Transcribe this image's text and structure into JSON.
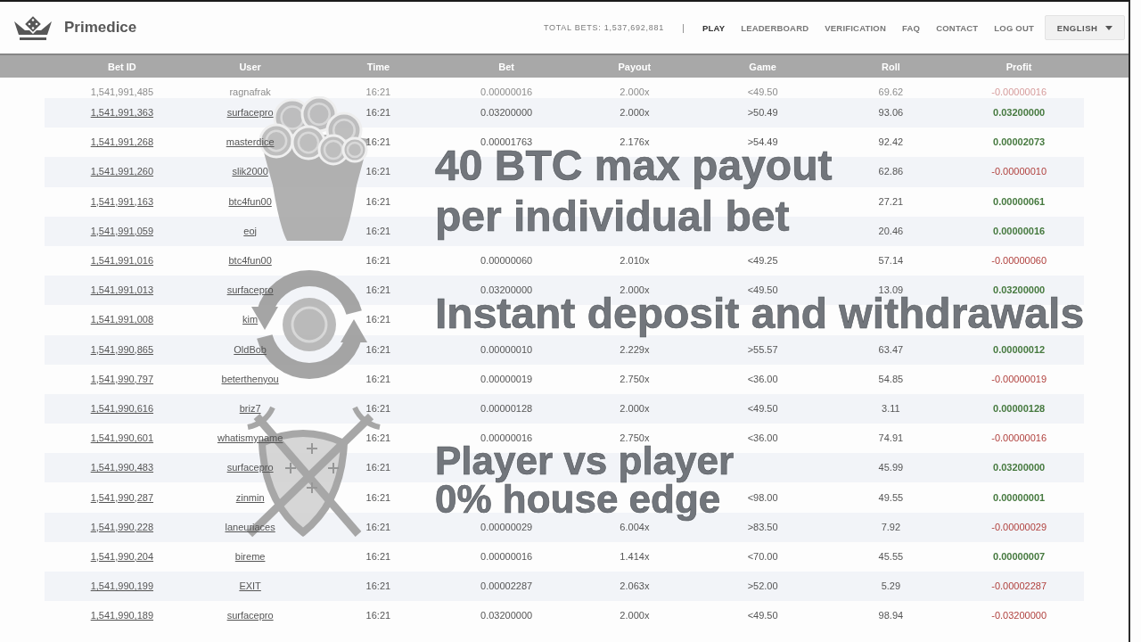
{
  "header": {
    "brand": "Primedice",
    "total_bets": "TOTAL BETS: 1,537,692,881",
    "separator": "|",
    "nav": [
      {
        "label": "PLAY",
        "selected": true
      },
      {
        "label": "LEADERBOARD",
        "selected": false
      },
      {
        "label": "VERIFICATION",
        "selected": false
      },
      {
        "label": "FAQ",
        "selected": false
      },
      {
        "label": "CONTACT",
        "selected": false
      },
      {
        "label": "LOG OUT",
        "selected": false
      }
    ],
    "language": "ENGLISH"
  },
  "table": {
    "columns": [
      "Bet ID",
      "User",
      "Time",
      "Bet",
      "Payout",
      "Game",
      "Roll",
      "Profit"
    ],
    "rows": [
      {
        "bet_id": "1,541,991,485",
        "user": "ragnafrak",
        "time": "16:21",
        "bet": "0.00000016",
        "payout": "2.000x",
        "game": "<49.50",
        "roll": "69.62",
        "profit": "-0.00000016",
        "won": false,
        "faded": true
      },
      {
        "bet_id": "1,541,991,363",
        "user": "surfacepro",
        "time": "16:21",
        "bet": "0.03200000",
        "payout": "2.000x",
        "game": ">50.49",
        "roll": "93.06",
        "profit": "0.03200000",
        "won": true,
        "faded": false
      },
      {
        "bet_id": "1,541,991,268",
        "user": "masterdice",
        "time": "16:21",
        "bet": "0.00001763",
        "payout": "2.176x",
        "game": ">54.49",
        "roll": "92.42",
        "profit": "0.00002073",
        "won": true,
        "faded": false
      },
      {
        "bet_id": "1,541,991,260",
        "user": "slik2000",
        "time": "16:21",
        "roll": "62.86",
        "profit": "-0.00000010",
        "won": false,
        "faded": false
      },
      {
        "bet_id": "1,541,991,163",
        "user": "btc4fun00",
        "time": "16:21",
        "roll": "27.21",
        "profit": "0.00000061",
        "won": true,
        "faded": false
      },
      {
        "bet_id": "1,541,991,059",
        "user": "eoj",
        "time": "16:21",
        "roll": "20.46",
        "profit": "0.00000016",
        "won": true,
        "faded": false
      },
      {
        "bet_id": "1,541,991,016",
        "user": "btc4fun00",
        "time": "16:21",
        "bet": "0.00000060",
        "payout": "2.010x",
        "game": "<49.25",
        "roll": "57.14",
        "profit": "-0.00000060",
        "won": false,
        "faded": false
      },
      {
        "bet_id": "1,541,991,013",
        "user": "surfacepro",
        "time": "16:21",
        "bet": "0.03200000",
        "payout": "2.000x",
        "game": "<49.50",
        "roll": "13.09",
        "profit": "0.03200000",
        "won": true,
        "faded": false
      },
      {
        "bet_id": "1,541,991,008",
        "user": "kim",
        "time": "16:21",
        "faded": false
      },
      {
        "bet_id": "1,541,990,865",
        "user": "OldBob",
        "time": "16:21",
        "bet": "0.00000010",
        "payout": "2.229x",
        "game": ">55.57",
        "roll": "63.47",
        "profit": "0.00000012",
        "won": true,
        "faded": false
      },
      {
        "bet_id": "1,541,990,797",
        "user": "beterthenyou",
        "time": "16:21",
        "bet": "0.00000019",
        "payout": "2.750x",
        "game": "<36.00",
        "roll": "54.85",
        "profit": "-0.00000019",
        "won": false,
        "faded": false
      },
      {
        "bet_id": "1,541,990,616",
        "user": "briz7",
        "time": "16:21",
        "bet": "0.00000128",
        "payout": "2.000x",
        "game": "<49.50",
        "roll": "3.11",
        "profit": "0.00000128",
        "won": true,
        "faded": false
      },
      {
        "bet_id": "1,541,990,601",
        "user": "whatismyname",
        "time": "16:21",
        "bet": "0.00000016",
        "payout": "2.750x",
        "game": "<36.00",
        "roll": "74.91",
        "profit": "-0.00000016",
        "won": false,
        "faded": false
      },
      {
        "bet_id": "1,541,990,483",
        "user": "surfacepro",
        "time": "16:21",
        "roll": "45.99",
        "profit": "0.03200000",
        "won": true,
        "faded": false
      },
      {
        "bet_id": "1,541,990,287",
        "user": "zinmin",
        "time": "16:21",
        "game": "<98.00",
        "roll": "49.55",
        "profit": "0.00000001",
        "won": true,
        "faded": false
      },
      {
        "bet_id": "1,541,990,228",
        "user": "laneuriaces",
        "time": "16:21",
        "bet": "0.00000029",
        "payout": "6.004x",
        "game": ">83.50",
        "roll": "7.92",
        "profit": "-0.00000029",
        "won": false,
        "faded": false
      },
      {
        "bet_id": "1,541,990,204",
        "user": "bireme",
        "time": "16:21",
        "bet": "0.00000016",
        "payout": "1.414x",
        "game": "<70.00",
        "roll": "45.55",
        "profit": "0.00000007",
        "won": true,
        "faded": false
      },
      {
        "bet_id": "1,541,990,199",
        "user": "EXIT",
        "time": "16:21",
        "bet": "0.00002287",
        "payout": "2.063x",
        "game": ">52.00",
        "roll": "5.29",
        "profit": "-0.00002287",
        "won": false,
        "faded": false
      },
      {
        "bet_id": "1,541,990,189",
        "user": "surfacepro",
        "time": "16:21",
        "bet": "0.03200000",
        "payout": "2.000x",
        "game": "<49.50",
        "roll": "98.94",
        "profit": "-0.03200000",
        "won": false,
        "faded": false
      }
    ]
  },
  "promos": [
    {
      "kind": "coins",
      "lines": [
        "40 BTC max payout",
        "per individual bet"
      ]
    },
    {
      "kind": "exchange",
      "lines": [
        "Instant deposit and withdrawals"
      ]
    },
    {
      "kind": "shield",
      "lines": [
        "Player vs player",
        "0% house edge"
      ]
    }
  ]
}
